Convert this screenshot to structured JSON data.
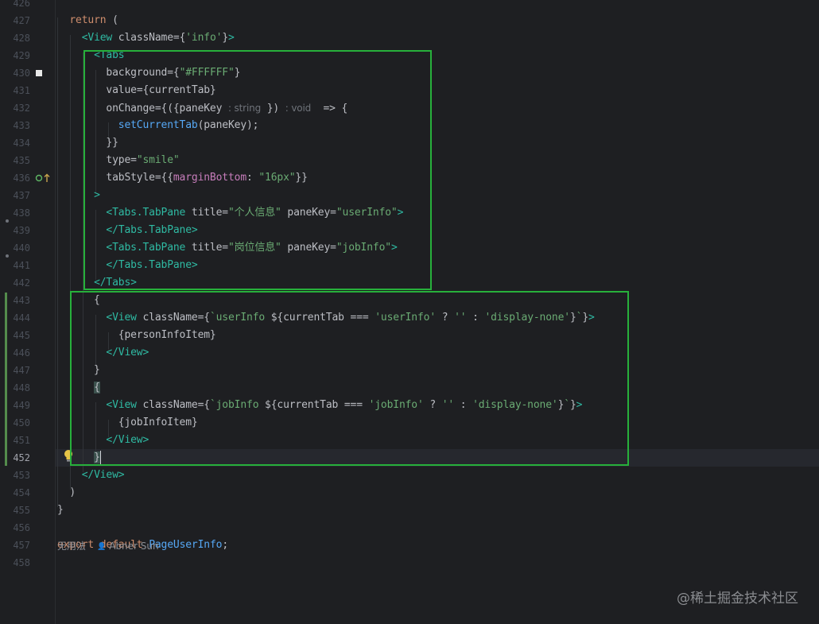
{
  "editor": {
    "current_line": "452",
    "lines": [
      {
        "num": "426",
        "tokens": []
      },
      {
        "num": "427",
        "tokens": [
          {
            "t": "ph",
            "v": "  "
          },
          {
            "t": "kw",
            "v": "return"
          },
          {
            "t": "ph",
            "v": " ("
          }
        ]
      },
      {
        "num": "428",
        "tokens": [
          {
            "t": "ph",
            "v": "    "
          },
          {
            "t": "tag",
            "v": "<View"
          },
          {
            "t": "attr",
            "v": " className"
          },
          {
            "t": "ph",
            "v": "={"
          },
          {
            "t": "str",
            "v": "'info'"
          },
          {
            "t": "ph",
            "v": "}"
          },
          {
            "t": "tag",
            "v": ">"
          }
        ]
      },
      {
        "num": "429",
        "tokens": [
          {
            "t": "ph",
            "v": "      "
          },
          {
            "t": "tag",
            "v": "<Tabs"
          }
        ]
      },
      {
        "num": "430",
        "tokens": [
          {
            "t": "ph",
            "v": "        "
          },
          {
            "t": "attr",
            "v": "background"
          },
          {
            "t": "ph",
            "v": "={"
          },
          {
            "t": "str",
            "v": "\"#FFFFFF\""
          },
          {
            "t": "ph",
            "v": "}"
          }
        ]
      },
      {
        "num": "431",
        "tokens": [
          {
            "t": "ph",
            "v": "        "
          },
          {
            "t": "attr",
            "v": "value"
          },
          {
            "t": "ph",
            "v": "={currentTab}"
          }
        ]
      },
      {
        "num": "432",
        "tokens": [
          {
            "t": "ph",
            "v": "        "
          },
          {
            "t": "attr",
            "v": "onChange"
          },
          {
            "t": "ph",
            "v": "={({paneKey "
          },
          {
            "t": "hint",
            "v": ": string"
          },
          {
            "t": "ph",
            "v": " }) "
          },
          {
            "t": "hint",
            "v": ": void"
          },
          {
            "t": "ph",
            "v": "  => {"
          }
        ]
      },
      {
        "num": "433",
        "tokens": [
          {
            "t": "ph",
            "v": "          "
          },
          {
            "t": "fn",
            "v": "setCurrentTab"
          },
          {
            "t": "ph",
            "v": "(paneKey);"
          }
        ]
      },
      {
        "num": "434",
        "tokens": [
          {
            "t": "ph",
            "v": "        }}"
          }
        ]
      },
      {
        "num": "435",
        "tokens": [
          {
            "t": "ph",
            "v": "        "
          },
          {
            "t": "attr",
            "v": "type"
          },
          {
            "t": "ph",
            "v": "="
          },
          {
            "t": "str",
            "v": "\"smile\""
          }
        ]
      },
      {
        "num": "436",
        "tokens": [
          {
            "t": "ph",
            "v": "        "
          },
          {
            "t": "attr",
            "v": "tabStyle"
          },
          {
            "t": "ph",
            "v": "={{"
          },
          {
            "t": "prop",
            "v": "marginBottom"
          },
          {
            "t": "ph",
            "v": ": "
          },
          {
            "t": "str",
            "v": "\"16px\""
          },
          {
            "t": "ph",
            "v": "}}"
          }
        ]
      },
      {
        "num": "437",
        "tokens": [
          {
            "t": "ph",
            "v": "      "
          },
          {
            "t": "tag",
            "v": ">"
          }
        ]
      },
      {
        "num": "438",
        "tokens": [
          {
            "t": "ph",
            "v": "        "
          },
          {
            "t": "tag",
            "v": "<Tabs.TabPane"
          },
          {
            "t": "attr",
            "v": " title"
          },
          {
            "t": "ph",
            "v": "="
          },
          {
            "t": "str",
            "v": "\"个人信息\""
          },
          {
            "t": "attr",
            "v": " paneKey"
          },
          {
            "t": "ph",
            "v": "="
          },
          {
            "t": "str",
            "v": "\"userInfo\""
          },
          {
            "t": "tag",
            "v": ">"
          }
        ]
      },
      {
        "num": "439",
        "tokens": [
          {
            "t": "ph",
            "v": "        "
          },
          {
            "t": "tag",
            "v": "</Tabs.TabPane>"
          }
        ]
      },
      {
        "num": "440",
        "tokens": [
          {
            "t": "ph",
            "v": "        "
          },
          {
            "t": "tag",
            "v": "<Tabs.TabPane"
          },
          {
            "t": "attr",
            "v": " title"
          },
          {
            "t": "ph",
            "v": "="
          },
          {
            "t": "str",
            "v": "\"岗位信息\""
          },
          {
            "t": "attr",
            "v": " paneKey"
          },
          {
            "t": "ph",
            "v": "="
          },
          {
            "t": "str",
            "v": "\"jobInfo\""
          },
          {
            "t": "tag",
            "v": ">"
          }
        ]
      },
      {
        "num": "441",
        "tokens": [
          {
            "t": "ph",
            "v": "        "
          },
          {
            "t": "tag",
            "v": "</Tabs.TabPane>"
          }
        ]
      },
      {
        "num": "442",
        "tokens": [
          {
            "t": "ph",
            "v": "      "
          },
          {
            "t": "tag",
            "v": "</Tabs>"
          }
        ]
      },
      {
        "num": "443",
        "tokens": [
          {
            "t": "ph",
            "v": "      {"
          }
        ]
      },
      {
        "num": "444",
        "tokens": [
          {
            "t": "ph",
            "v": "        "
          },
          {
            "t": "tag",
            "v": "<View"
          },
          {
            "t": "attr",
            "v": " className"
          },
          {
            "t": "ph",
            "v": "={"
          },
          {
            "t": "str",
            "v": "`userInfo "
          },
          {
            "t": "ph",
            "v": "${currentTab === "
          },
          {
            "t": "str",
            "v": "'userInfo'"
          },
          {
            "t": "ph",
            "v": " ? "
          },
          {
            "t": "str",
            "v": "''"
          },
          {
            "t": "ph",
            "v": " : "
          },
          {
            "t": "str",
            "v": "'display-none'"
          },
          {
            "t": "ph",
            "v": "}"
          },
          {
            "t": "str",
            "v": "`"
          },
          {
            "t": "ph",
            "v": "}"
          },
          {
            "t": "tag",
            "v": ">"
          }
        ]
      },
      {
        "num": "445",
        "tokens": [
          {
            "t": "ph",
            "v": "          {personInfoItem}"
          }
        ]
      },
      {
        "num": "446",
        "tokens": [
          {
            "t": "ph",
            "v": "        "
          },
          {
            "t": "tag",
            "v": "</View>"
          }
        ]
      },
      {
        "num": "447",
        "tokens": [
          {
            "t": "ph",
            "v": "      }"
          }
        ]
      },
      {
        "num": "448",
        "tokens": [
          {
            "t": "ph",
            "v": "      "
          },
          {
            "t": "hl",
            "v": "{"
          }
        ]
      },
      {
        "num": "449",
        "tokens": [
          {
            "t": "ph",
            "v": "        "
          },
          {
            "t": "tag",
            "v": "<View"
          },
          {
            "t": "attr",
            "v": " className"
          },
          {
            "t": "ph",
            "v": "={"
          },
          {
            "t": "str",
            "v": "`jobInfo "
          },
          {
            "t": "ph",
            "v": "${currentTab === "
          },
          {
            "t": "str",
            "v": "'jobInfo'"
          },
          {
            "t": "ph",
            "v": " ? "
          },
          {
            "t": "str",
            "v": "''"
          },
          {
            "t": "ph",
            "v": " : "
          },
          {
            "t": "str",
            "v": "'display-none'"
          },
          {
            "t": "ph",
            "v": "}"
          },
          {
            "t": "str",
            "v": "`"
          },
          {
            "t": "ph",
            "v": "}"
          },
          {
            "t": "tag",
            "v": ">"
          }
        ]
      },
      {
        "num": "450",
        "tokens": [
          {
            "t": "ph",
            "v": "          {jobInfoItem}"
          }
        ]
      },
      {
        "num": "451",
        "tokens": [
          {
            "t": "ph",
            "v": "        "
          },
          {
            "t": "tag",
            "v": "</View>"
          }
        ]
      },
      {
        "num": "452",
        "tokens": [
          {
            "t": "ph",
            "v": "      "
          },
          {
            "t": "hl",
            "v": "}"
          },
          {
            "t": "caret",
            "v": ""
          }
        ]
      },
      {
        "num": "453",
        "tokens": [
          {
            "t": "ph",
            "v": "    "
          },
          {
            "t": "tag",
            "v": "</View>"
          }
        ]
      },
      {
        "num": "454",
        "tokens": [
          {
            "t": "ph",
            "v": "  )"
          }
        ]
      },
      {
        "num": "455",
        "tokens": [
          {
            "t": "ph",
            "v": "}"
          }
        ]
      },
      {
        "num": "456",
        "tokens": []
      },
      {
        "num": "457",
        "tokens": [
          {
            "t": "kw",
            "v": "export"
          },
          {
            "t": "ph",
            "v": " "
          },
          {
            "t": "kw",
            "v": "default"
          },
          {
            "t": "ph",
            "v": " "
          },
          {
            "t": "fn",
            "v": "PageUserInfo"
          },
          {
            "t": "ph",
            "v": ";"
          }
        ]
      },
      {
        "num": "458",
        "tokens": []
      }
    ]
  },
  "inlay_hint": {
    "usages": "无用法",
    "author": "Abner Sun"
  },
  "watermark": "@稀土掘金技术社区",
  "colors": {
    "background": "#1e1f22",
    "keyword": "#cf8e6d",
    "tag": "#2fbaa3",
    "string": "#6aab73",
    "function": "#56a8f5",
    "property": "#c77dbb",
    "annotation_box": "#27b03b"
  }
}
